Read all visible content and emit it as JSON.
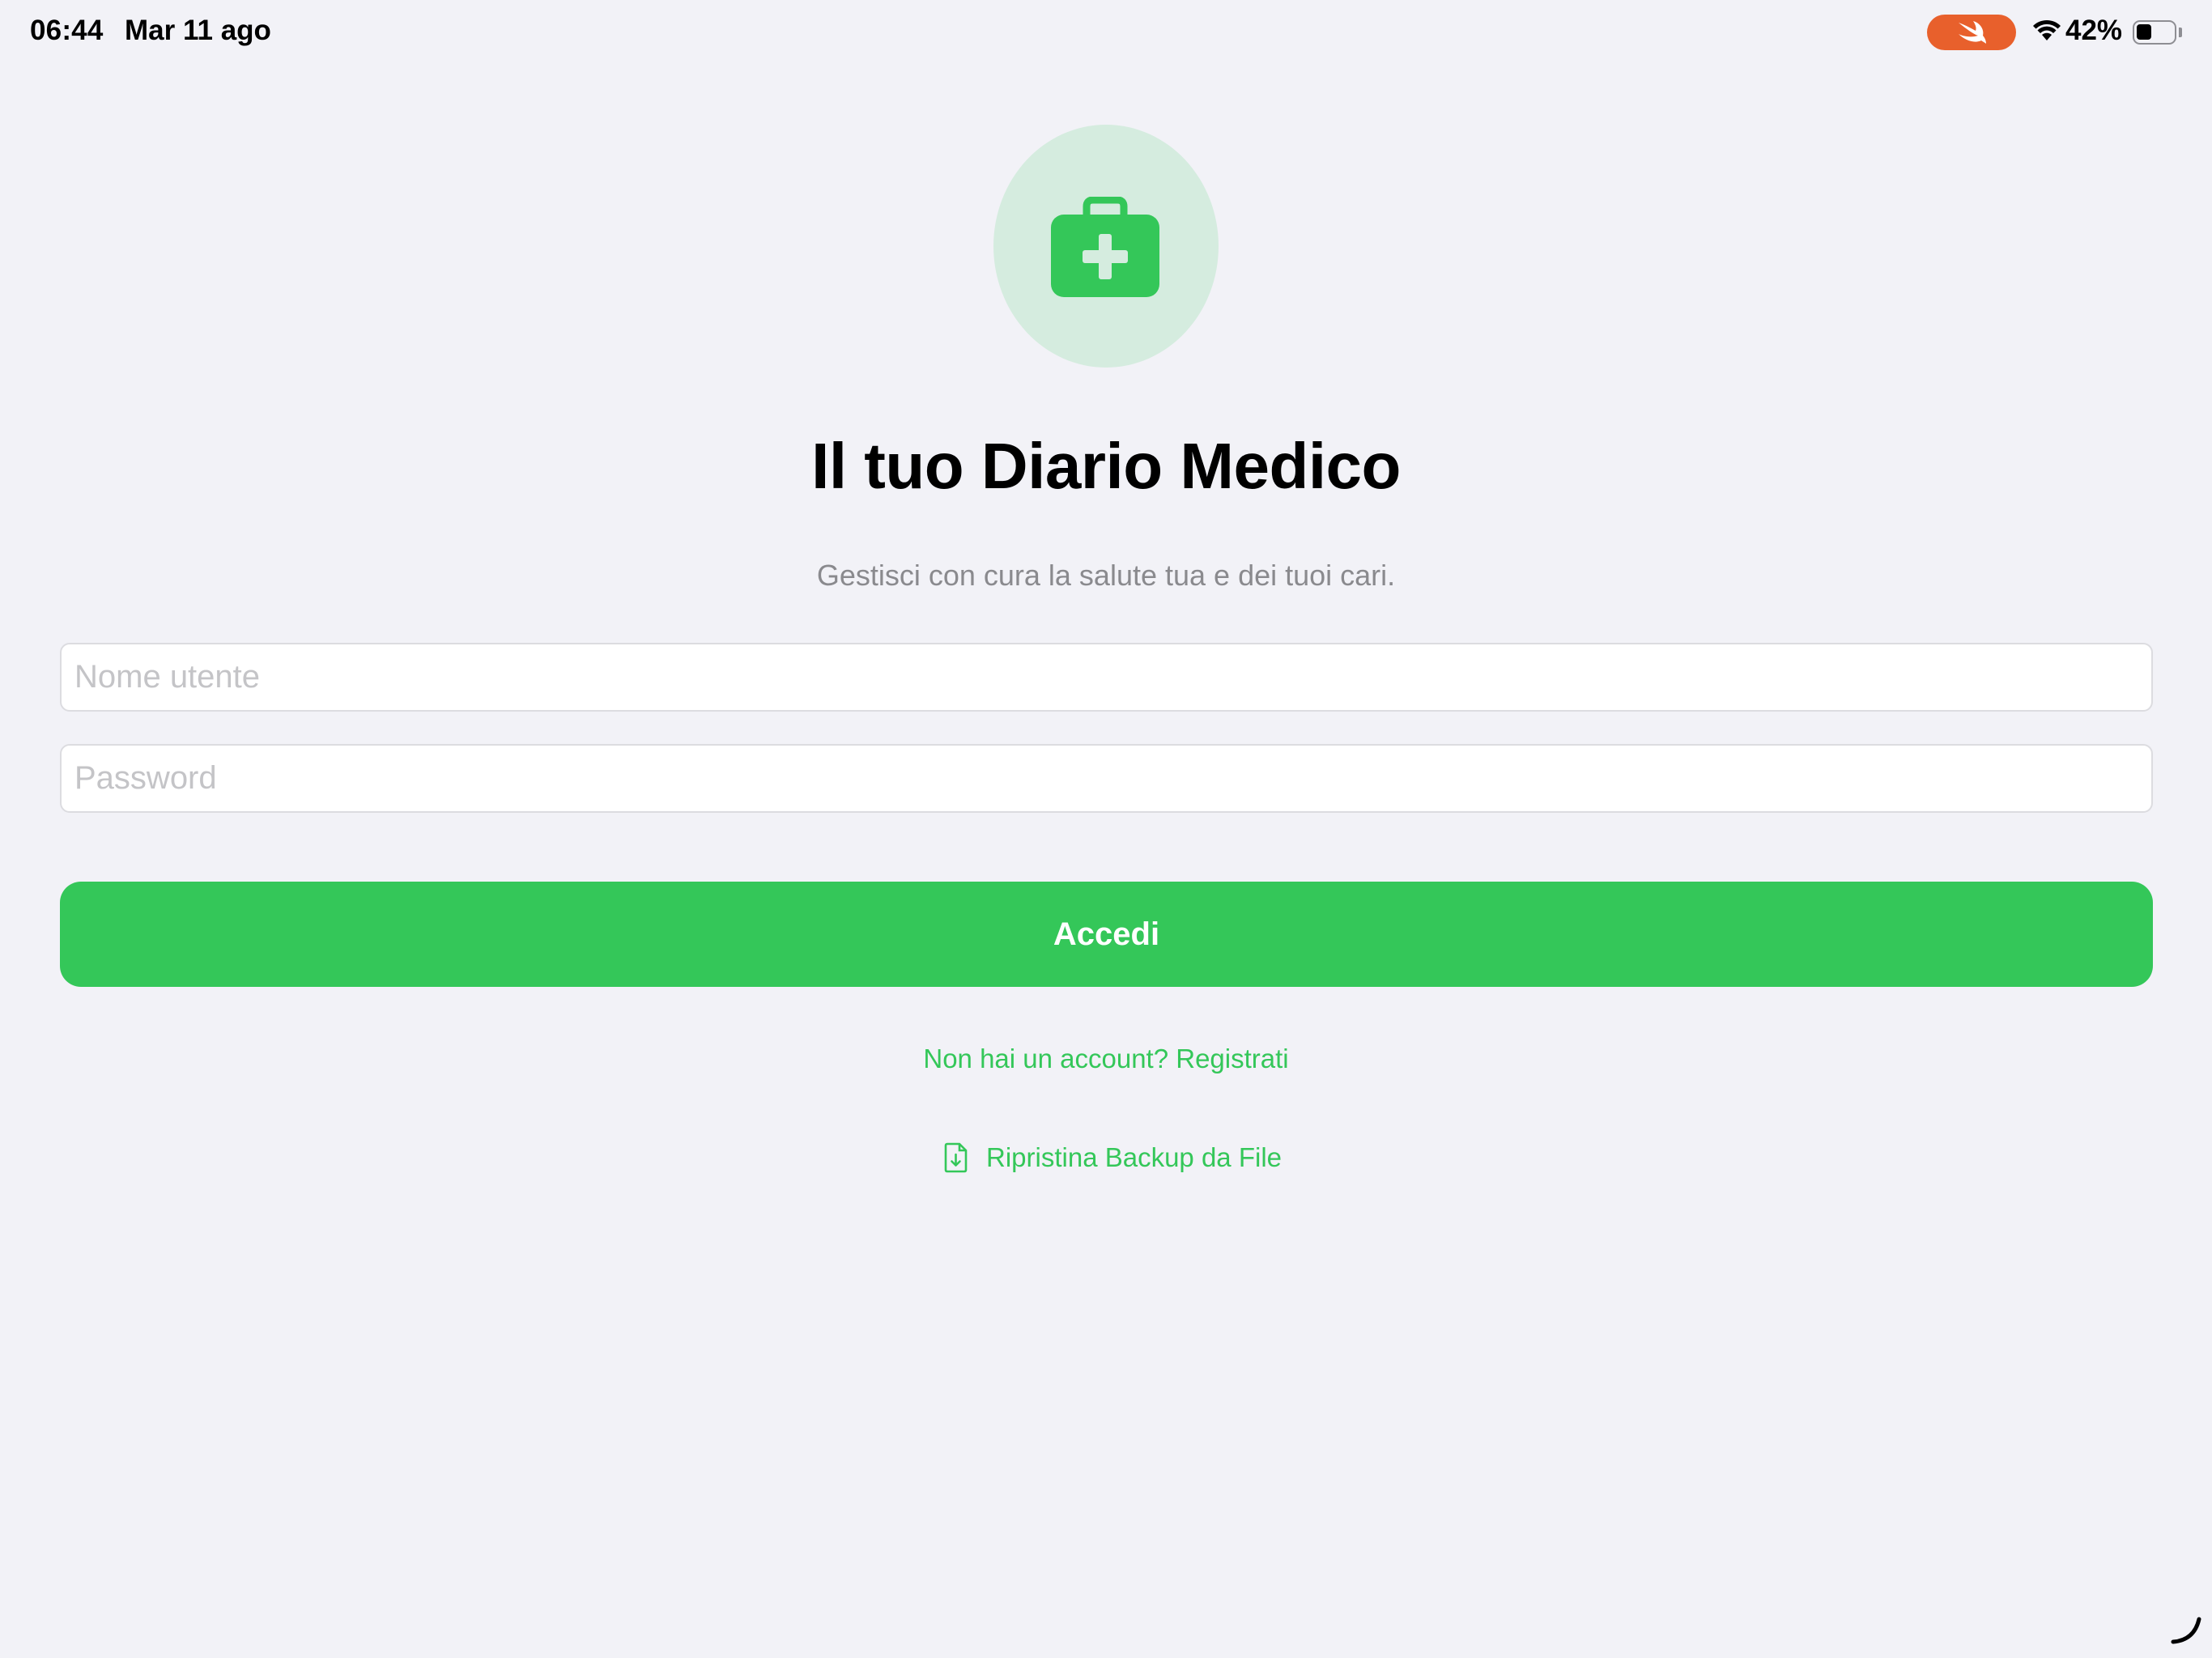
{
  "status_bar": {
    "time": "06:44",
    "date": "Mar 11 ago",
    "battery_percent": "42%",
    "battery_level": 0.42,
    "swift_badge_icon": "swift-icon",
    "wifi_icon": "wifi-icon",
    "battery_icon": "battery-icon"
  },
  "logo": {
    "icon": "medical-bag-icon",
    "accent_color": "#34c759",
    "background_color": "#d5ecdf"
  },
  "title": "Il tuo Diario Medico",
  "subtitle": "Gestisci con cura la salute tua e dei tuoi cari.",
  "form": {
    "username": {
      "placeholder": "Nome utente",
      "value": ""
    },
    "password": {
      "placeholder": "Password",
      "value": ""
    },
    "login_label": "Accedi"
  },
  "links": {
    "register_label": "Non hai un account? Registrati",
    "restore_label": "Ripristina Backup da File",
    "restore_icon": "document-download-icon"
  },
  "colors": {
    "accent": "#34c759",
    "background": "#f2f2f7",
    "swift_badge": "#e8602c"
  }
}
